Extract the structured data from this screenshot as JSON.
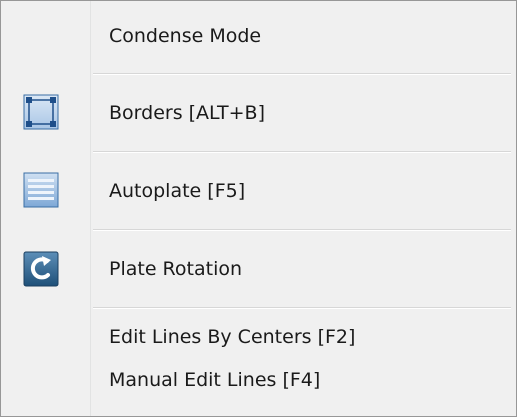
{
  "menu": {
    "items": [
      {
        "label": "Condense Mode",
        "icon": null
      },
      {
        "label": "Borders [ALT+B]",
        "icon": "borders-icon"
      },
      {
        "label": "Autoplate [F5]",
        "icon": "autoplate-icon"
      },
      {
        "label": "Plate Rotation",
        "icon": "rotation-icon"
      },
      {
        "label": "Edit Lines By Centers [F2]",
        "icon": null
      },
      {
        "label": "Manual Edit Lines [F4]",
        "icon": null
      }
    ]
  },
  "colors": {
    "menu_background": "#f0f0f0",
    "border": "#979797",
    "separator": "#d7d7d7",
    "icon_blue": "#3a78b8",
    "icon_light_blue": "#c9dcef"
  }
}
